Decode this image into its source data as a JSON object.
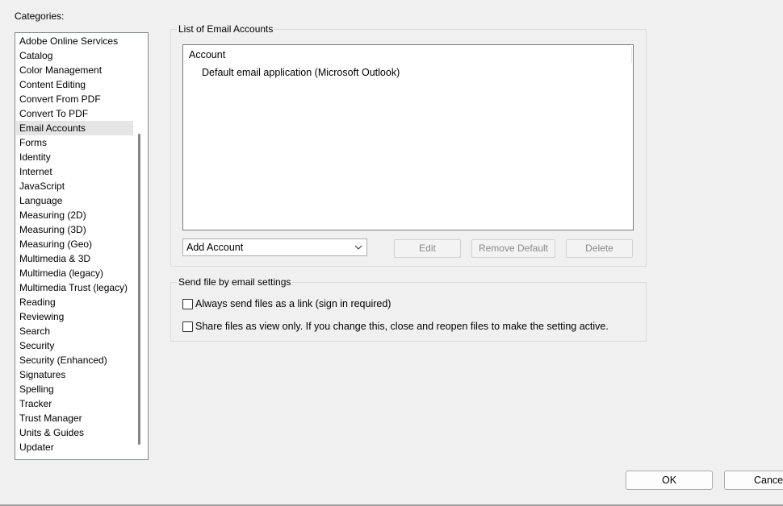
{
  "categories": {
    "label": "Categories:",
    "selected_index": 6,
    "items": [
      "Adobe Online Services",
      "Catalog",
      "Color Management",
      "Content Editing",
      "Convert From PDF",
      "Convert To PDF",
      "Email Accounts",
      "Forms",
      "Identity",
      "Internet",
      "JavaScript",
      "Language",
      "Measuring (2D)",
      "Measuring (3D)",
      "Measuring (Geo)",
      "Multimedia & 3D",
      "Multimedia (legacy)",
      "Multimedia Trust (legacy)",
      "Reading",
      "Reviewing",
      "Search",
      "Security",
      "Security (Enhanced)",
      "Signatures",
      "Spelling",
      "Tracker",
      "Trust Manager",
      "Units & Guides",
      "Updater"
    ]
  },
  "accounts": {
    "group_title": "List of Email Accounts",
    "column_header": "Account",
    "rows": [
      "Default email application (Microsoft Outlook)"
    ],
    "add_account_value": "Add Account",
    "edit_label": "Edit",
    "remove_default_label": "Remove Default",
    "delete_label": "Delete"
  },
  "send_settings": {
    "group_title": "Send file by email settings",
    "always_link_label": "Always send files as a link (sign in required)",
    "always_link_checked": false,
    "view_only_label": "Share files as view only. If you change this, close and reopen files to make the setting active.",
    "view_only_checked": false
  },
  "dialog": {
    "ok_label": "OK",
    "cancel_label": "Cancel"
  },
  "icons": {
    "dropdown": "chevron-down-icon",
    "checkbox": "checkbox-icon"
  },
  "colors": {
    "background": "#f0f0f0",
    "selected_item": "#e5e5e5",
    "disabled_text": "#8a8a8a"
  }
}
